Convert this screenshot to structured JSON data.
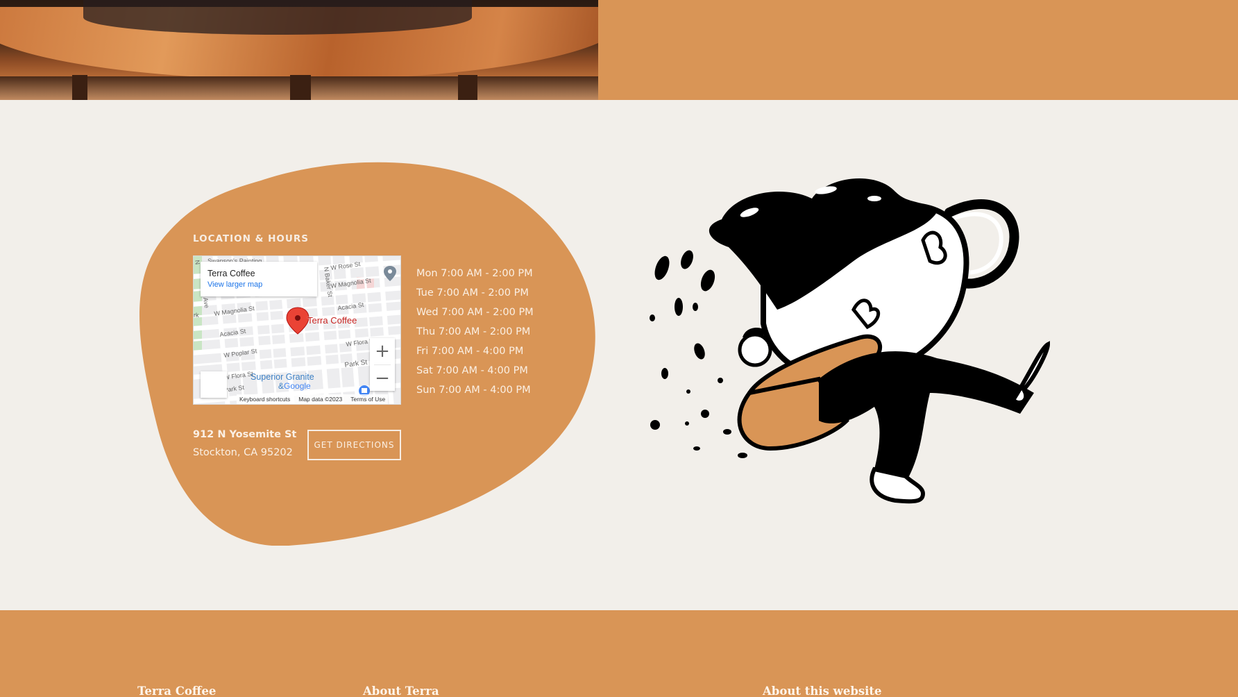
{
  "colors": {
    "accent": "#D99556",
    "background": "#F2EFEA",
    "text_light": "#FBF0E4"
  },
  "location": {
    "title": "LOCATION & HOURS",
    "map": {
      "place_name": "Terra Coffee",
      "larger_map_link": "View larger map",
      "pin_label": "Terra Coffee",
      "business_label": "Superior Granite",
      "business_label_2": "&",
      "google_logo": "Google",
      "zoom_in": "+",
      "zoom_out": "−",
      "footer": [
        "Keyboard shortcuts",
        "Map data ©2023",
        "Terms of Use"
      ],
      "streets": [
        "Swanson's Painting",
        "W Rose St",
        "W Magnolia St",
        "N Baker St",
        "W Magnolia St",
        "Acacia St",
        "Acacia St",
        "W Poplar St",
        "W Flora St",
        "W Flora St",
        "Park St",
        "Park St",
        "rk",
        "Ave",
        "N"
      ]
    },
    "hours": [
      "Mon 7:00 AM - 2:00 PM",
      "Tue 7:00 AM - 2:00 PM",
      "Wed 7:00 AM - 2:00 PM",
      "Thu 7:00 AM - 2:00 PM",
      "Fri 7:00 AM - 4:00 PM",
      "Sat 7:00 AM - 4:00 PM",
      "Sun 7:00 AM - 4:00 PM"
    ],
    "address_line1": "912 N Yosemite St",
    "address_line2": "Stockton, CA 95202",
    "directions_button": "GET DIRECTIONS"
  },
  "illustration": {
    "icon": "coffee-cup-person-illustration"
  },
  "footer": {
    "col1": "Terra Coffee",
    "col2": "About Terra",
    "col3": "About this website"
  }
}
